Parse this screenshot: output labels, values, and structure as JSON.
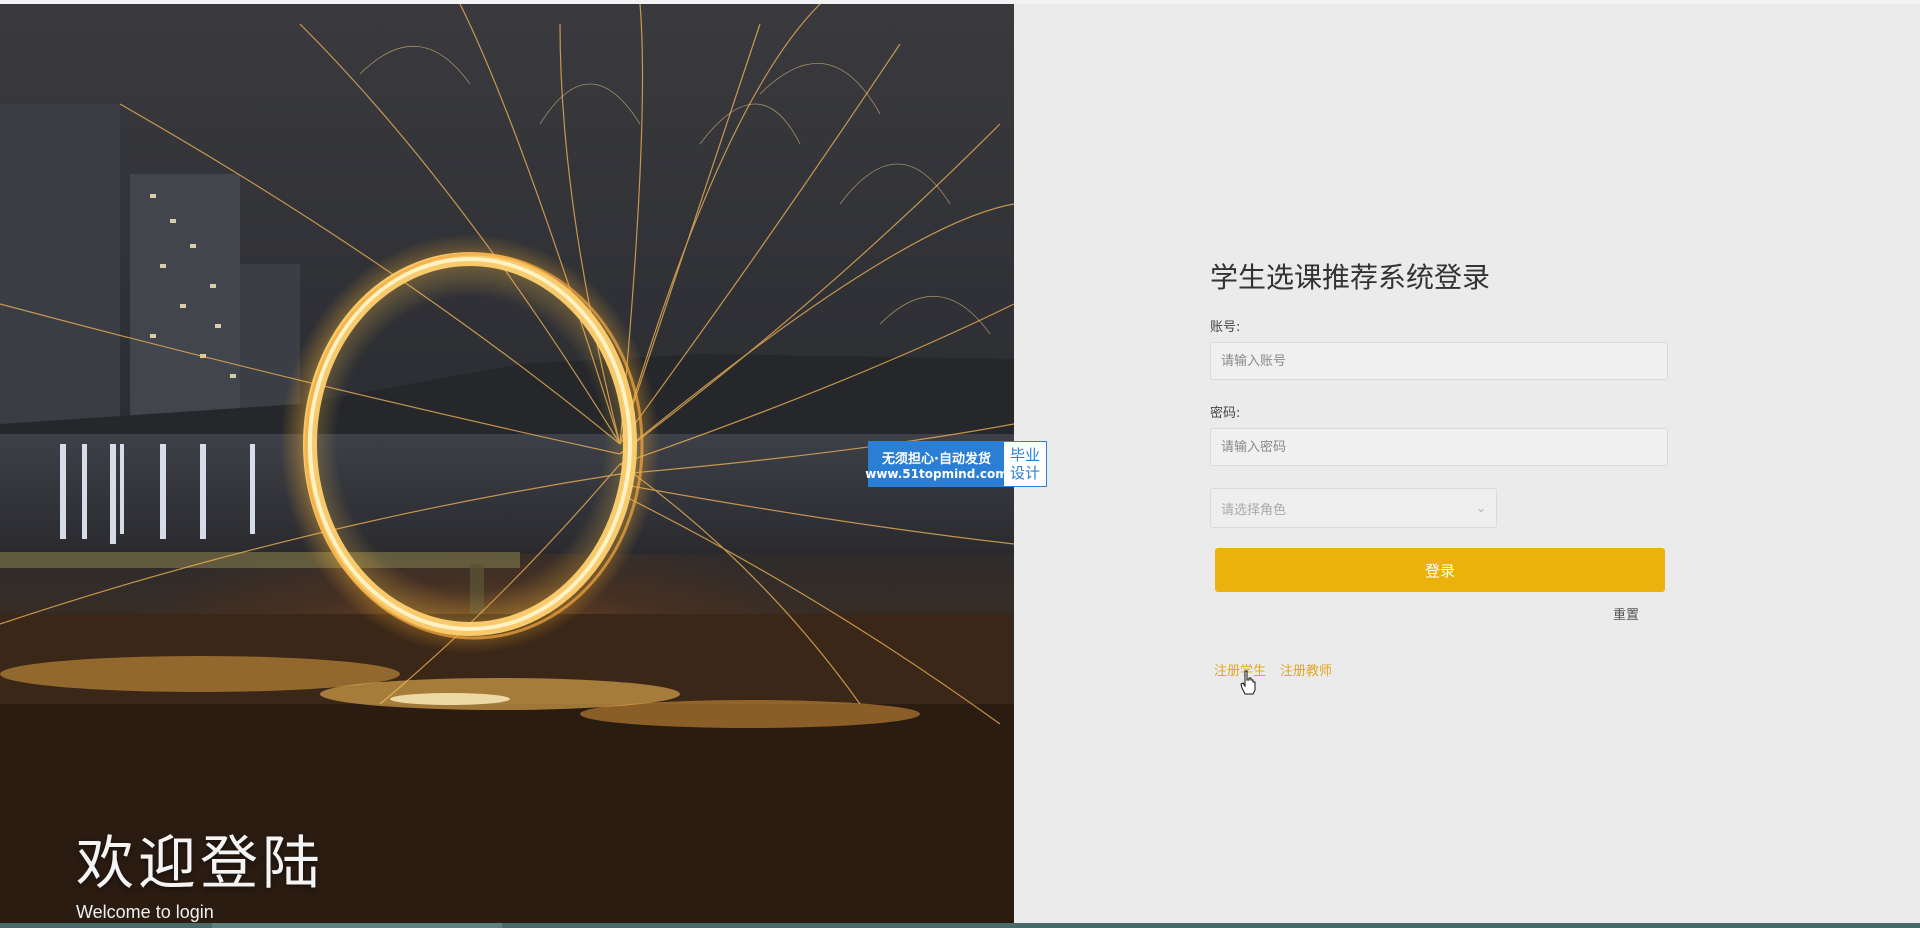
{
  "hero": {
    "title": "欢迎登陆",
    "subtitle": "Welcome to login"
  },
  "watermark": {
    "line1": "无须担心·自动发货",
    "line2": "www.51topmind.com",
    "right_line1": "毕业",
    "right_line2": "设计"
  },
  "login": {
    "title": "学生选课推荐系统登录",
    "account_label": "账号:",
    "account_placeholder": "请输入账号",
    "password_label": "密码:",
    "password_placeholder": "请输入密码",
    "role_placeholder": "请选择角色",
    "submit_label": "登录",
    "reset_label": "重置",
    "register_student": "注册学生",
    "register_teacher": "注册教师"
  },
  "colors": {
    "accent": "#ebb20e",
    "link": "#e0a81e",
    "watermark_blue": "#2a7fd4"
  },
  "icons": {
    "select_chevron": "chevron-down-icon",
    "cursor": "hand-pointer-icon"
  }
}
